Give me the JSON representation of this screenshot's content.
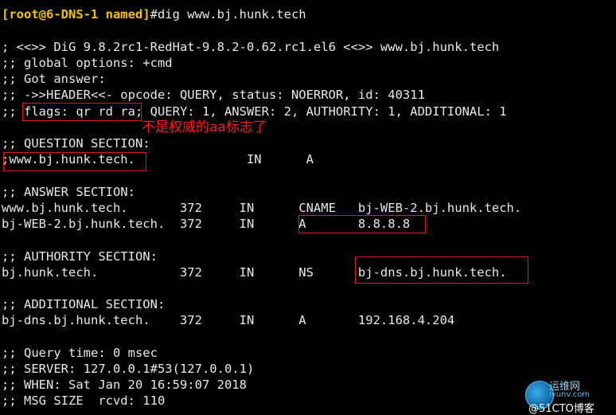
{
  "terminal": {
    "prompt": "[root@6-DNS-1 named]",
    "command": "#dig www.bj.hunk.tech",
    "lines": [
      "; <<>> DiG 9.8.2rc1-RedHat-9.8.2-0.62.rc1.el6 <<>> www.bj.hunk.tech",
      ";; global options: +cmd",
      ";; Got answer:",
      ";; ->>HEADER<<- opcode: QUERY, status: NOERROR, id: 40311",
      ";; flags: qr rd ra; QUERY: 1, ANSWER: 2, AUTHORITY: 1, ADDITIONAL: 1",
      ";; QUESTION SECTION:",
      ";www.bj.hunk.tech.               IN      A",
      ";; ANSWER SECTION:",
      "www.bj.hunk.tech.       372     IN      CNAME   bj-WEB-2.bj.hunk.tech.",
      "bj-WEB-2.bj.hunk.tech.  372     IN      A       8.8.8.8",
      ";; AUTHORITY SECTION:",
      "bj.hunk.tech.           372     IN      NS      bj-dns.bj.hunk.tech.",
      ";; ADDITIONAL SECTION:",
      "bj-dns.bj.hunk.tech.    372     IN      A       192.168.4.204",
      ";; Query time: 0 msec",
      ";; SERVER: 127.0.0.1#53(127.0.0.1)",
      ";; WHEN: Sat Jan 20 16:59:07 2018",
      ";; MSG SIZE  rcvd: 110"
    ]
  },
  "annotation": {
    "note": "不是权威的aa标志了",
    "color": "#e01818"
  },
  "watermark": {
    "line1": "运维网",
    "line2": "iyunv.com",
    "line3": "@51CTO博客"
  }
}
